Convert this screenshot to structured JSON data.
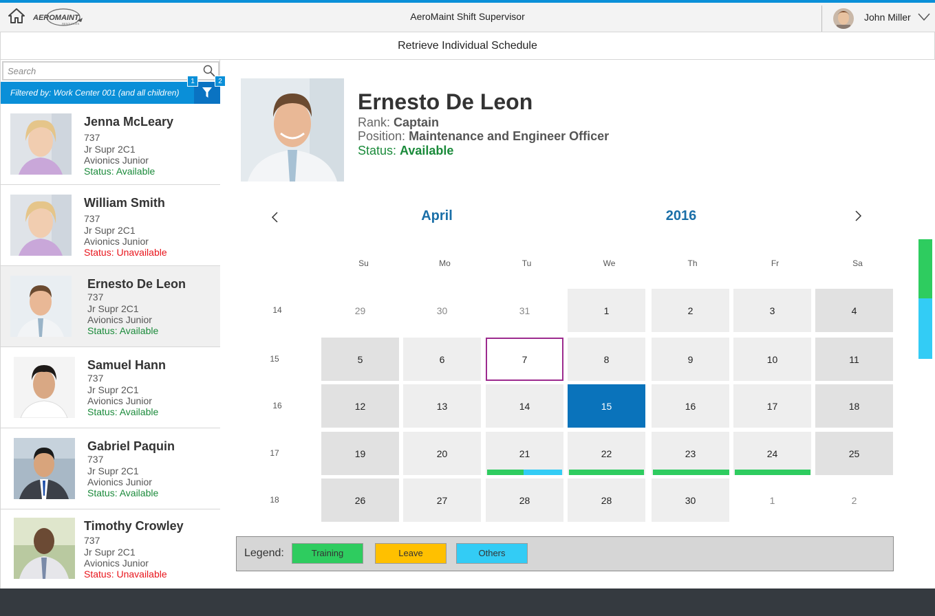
{
  "header": {
    "app_title": "AeroMaint Shift Supervisor",
    "logo_text": "AEROMAINT",
    "logo_subtext": "RESOURCES",
    "user_name": "John Miller"
  },
  "page_title": "Retrieve Individual Schedule",
  "sidebar": {
    "search_placeholder": "Search",
    "filter_text": "Filtered by: Work Center 001 (and all children)",
    "badge_1": "1",
    "badge_2": "2",
    "people": [
      {
        "name": "Jenna McLeary",
        "aircraft": "737",
        "role": "Jr Supr 2C1",
        "team": "Avionics Junior",
        "status": "Status: Available",
        "available": true
      },
      {
        "name": "William Smith",
        "aircraft": "737",
        "role": "Jr Supr 2C1",
        "team": "Avionics Junior",
        "status": "Status: Unavailable",
        "available": false
      },
      {
        "name": "Ernesto De Leon",
        "aircraft": "737",
        "role": "Jr Supr 2C1",
        "team": "Avionics Junior",
        "status": "Status: Available",
        "available": true
      },
      {
        "name": "Samuel Hann",
        "aircraft": "737",
        "role": "Jr Supr 2C1",
        "team": "Avionics Junior",
        "status": "Status: Available",
        "available": true
      },
      {
        "name": "Gabriel Paquin",
        "aircraft": "737",
        "role": "Jr Supr 2C1",
        "team": "Avionics Junior",
        "status": "Status: Available",
        "available": true
      },
      {
        "name": "Timothy Crowley",
        "aircraft": "737",
        "role": "Jr Supr 2C1",
        "team": "Avionics Junior",
        "status": "Status: Unavailable",
        "available": false
      }
    ]
  },
  "employee": {
    "name": "Ernesto De Leon",
    "rank_label": "Rank:",
    "rank": "Captain",
    "position_label": "Position:",
    "position": "Maintenance and Engineer Officer",
    "status_label": "Status:",
    "status": "Available"
  },
  "calendar": {
    "month": "April",
    "year": "2016",
    "weekdays": [
      "Su",
      "Mo",
      "Tu",
      "We",
      "Th",
      "Fr",
      "Sa"
    ],
    "weeks": [
      {
        "week": "14",
        "days": [
          "29",
          "30",
          "31",
          "1",
          "2",
          "3",
          "4"
        ]
      },
      {
        "week": "15",
        "days": [
          "5",
          "6",
          "7",
          "8",
          "9",
          "10",
          "11"
        ]
      },
      {
        "week": "16",
        "days": [
          "12",
          "13",
          "14",
          "15",
          "16",
          "17",
          "18"
        ]
      },
      {
        "week": "17",
        "days": [
          "19",
          "20",
          "21",
          "22",
          "23",
          "24",
          "25"
        ]
      },
      {
        "week": "18",
        "days": [
          "26",
          "27",
          "28",
          "28",
          "30",
          "1",
          "2"
        ]
      }
    ]
  },
  "legend": {
    "label": "Legend:",
    "items": [
      {
        "label": "Training",
        "color": "#2ecc5f"
      },
      {
        "label": "Leave",
        "color": "#ffc000"
      },
      {
        "label": "Others",
        "color": "#33ccf5"
      }
    ]
  }
}
